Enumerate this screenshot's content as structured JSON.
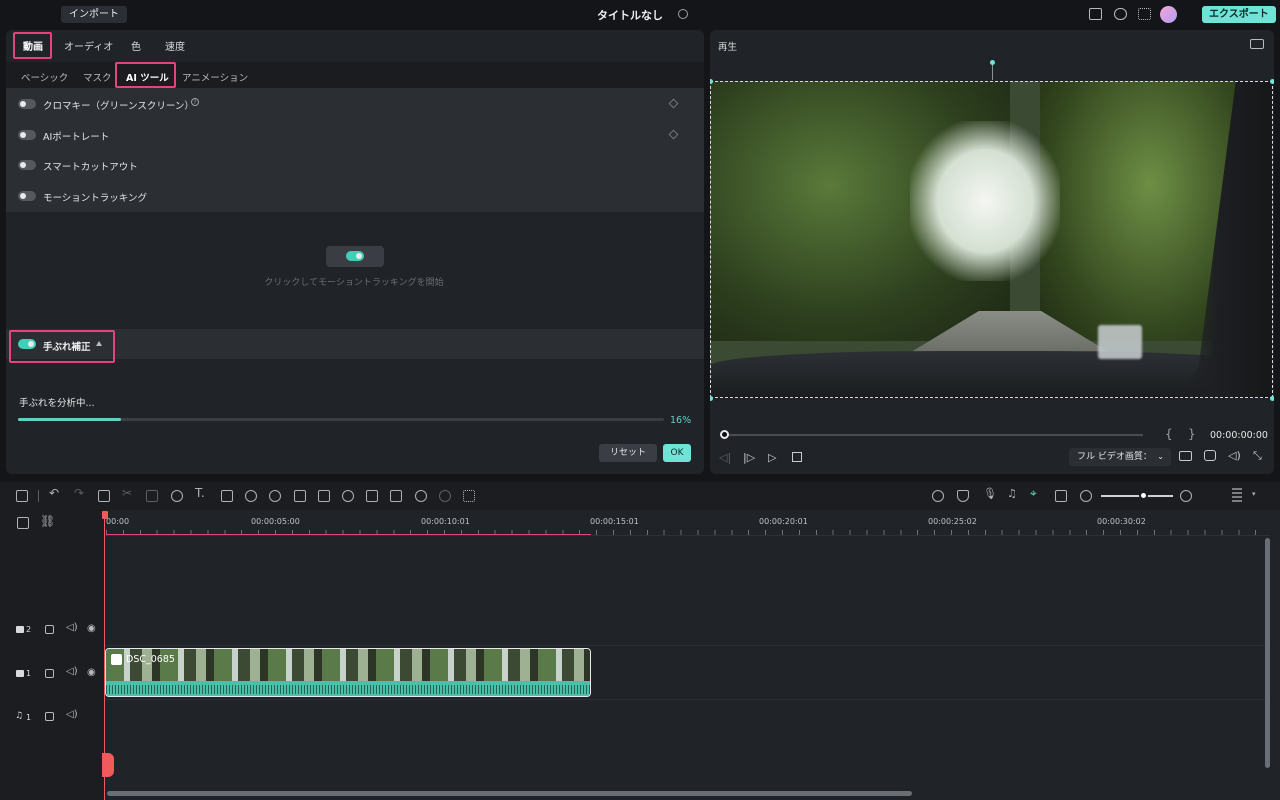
{
  "topbar": {
    "import_label": "インポート",
    "title": "タイトルなし",
    "export_label": "エクスポート",
    "icons": [
      "layout-icon",
      "cloud-upload-icon",
      "grid-apps-icon"
    ]
  },
  "left_panel": {
    "main_tabs": [
      {
        "label": "動画",
        "active": true
      },
      {
        "label": "オーディオ"
      },
      {
        "label": "色"
      },
      {
        "label": "速度"
      }
    ],
    "sub_tabs": [
      {
        "label": "ベーシック"
      },
      {
        "label": "マスク"
      },
      {
        "label": "AI ツール",
        "active": true
      },
      {
        "label": "アニメーション"
      }
    ],
    "features": [
      {
        "label": "クロマキー（グリーンスクリーン）",
        "enabled": false,
        "has_help": true
      },
      {
        "label": "AIポートレート",
        "enabled": false
      },
      {
        "label": "スマートカットアウト",
        "enabled": false
      },
      {
        "label": "モーショントラッキング",
        "enabled": false
      }
    ],
    "tracking_hint": "クリックしてモーショントラッキングを開始",
    "stabilization": {
      "label": "手ぶれ補正",
      "enabled": true,
      "status_text": "手ぶれを分析中...",
      "progress": 0.16,
      "progress_text": "16%"
    },
    "reset_label": "リセット",
    "ok_label": "OK"
  },
  "preview": {
    "label": "再生",
    "timecode": "00:00:00:00",
    "brace_in": "{",
    "brace_out": "}",
    "quality": "フル ビデオ画質：",
    "playhead_fraction": 0.0
  },
  "timeline": {
    "ruler_labels": [
      "00:00",
      "00:00:05:00",
      "00:00:10:01",
      "00:00:15:01",
      "00:00:20:01",
      "00:00:25:02",
      "00:00:30:02"
    ],
    "tracks": [
      {
        "id": "video-2",
        "label": "2"
      },
      {
        "id": "video-1",
        "label": "1"
      },
      {
        "id": "audio-1",
        "label": "1"
      }
    ],
    "clip": {
      "name": "DSC_0685"
    }
  },
  "colors": {
    "accent": "#6fe3d5",
    "highlight": "#e0457b",
    "playhead": "#f05a5a",
    "panel_bg": "#202327"
  }
}
